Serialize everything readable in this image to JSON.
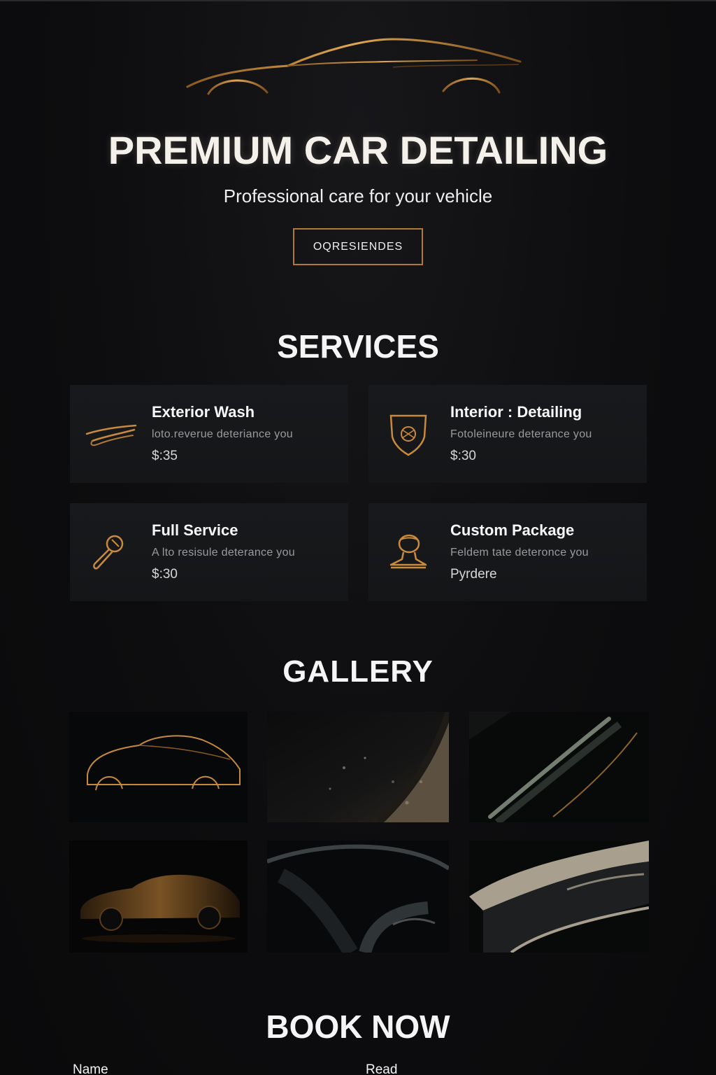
{
  "hero": {
    "title": "PREMIUM CAR DETAILING",
    "subtitle": "Professional care for your vehicle",
    "cta_label": "OQRESIENDES",
    "logo_icon": "car-silhouette-icon"
  },
  "colors": {
    "background": "#0c0c0d",
    "accent_gold": "#b07a35",
    "card_bg": "#16181b",
    "text_primary": "#f4f4f4",
    "text_muted": "#9a9b9e"
  },
  "services": {
    "title": "SERVICES",
    "items": [
      {
        "name": "Exterior Wash",
        "description": "loto.reverue deteriance you",
        "price": "$:35",
        "icon": "wash-streak-icon"
      },
      {
        "name": "Interior : Detailing",
        "description": "Fotoleineure deterance you",
        "price": "$:30",
        "icon": "shield-crest-icon"
      },
      {
        "name": "Full Service",
        "description": "A lto resisule deterance you",
        "price": "$:30",
        "icon": "wrench-icon"
      },
      {
        "name": "Custom Package",
        "description": "Feldem tate deteronce you",
        "price": "Pyrdere",
        "icon": "person-bust-icon"
      }
    ]
  },
  "gallery": {
    "title": "GALLERY",
    "images": [
      {
        "subject": "car-outline-gold"
      },
      {
        "subject": "textured-surface-closeup"
      },
      {
        "subject": "body-curve-reflection"
      },
      {
        "subject": "dark-car-profile"
      },
      {
        "subject": "interior-seat-closeup"
      },
      {
        "subject": "headlight-closeup"
      }
    ]
  },
  "booking": {
    "title": "BOOK NOW",
    "fields": [
      {
        "label": "Name"
      },
      {
        "label": "Read"
      }
    ]
  }
}
